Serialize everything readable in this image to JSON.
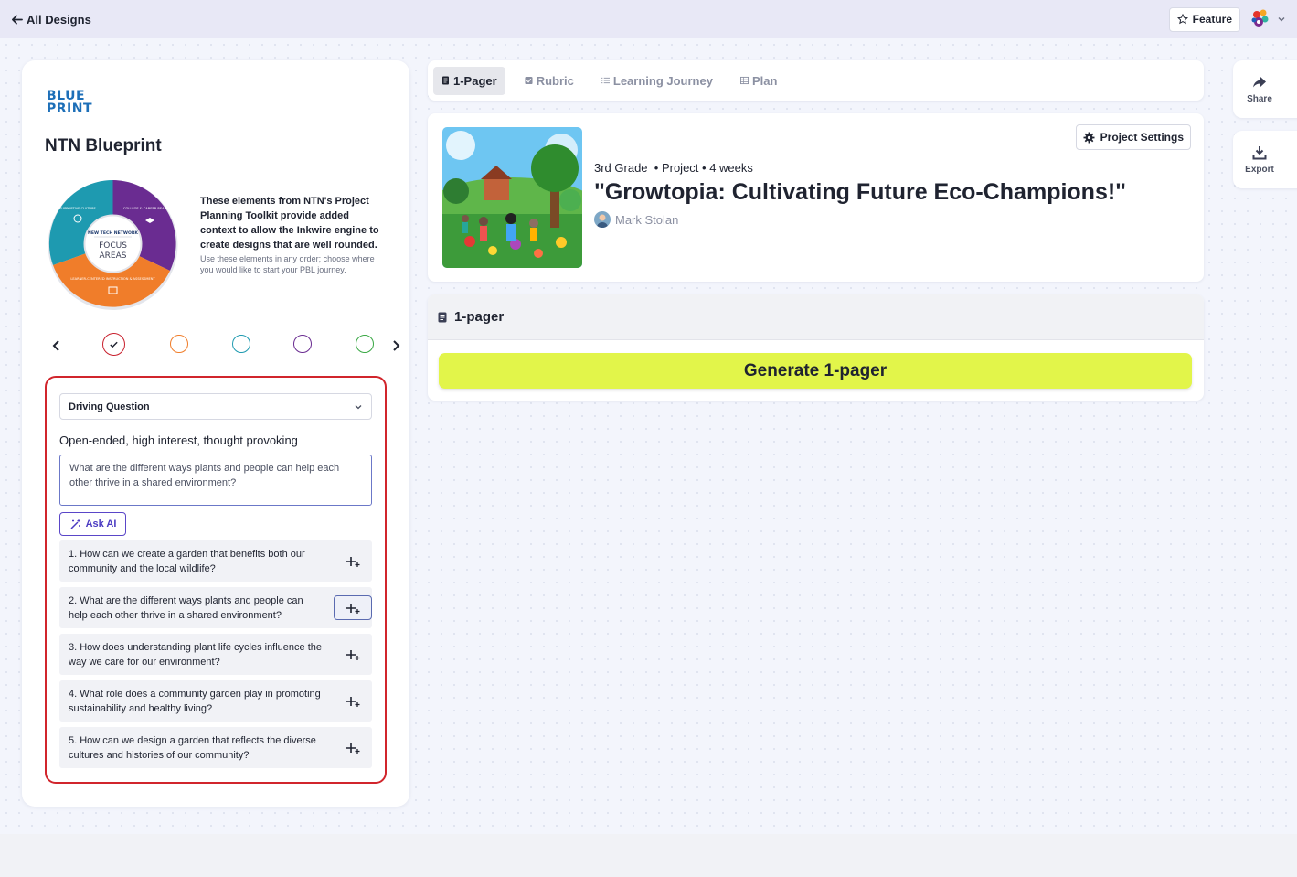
{
  "topbar": {
    "back_label": "All Designs",
    "feature_label": "Feature"
  },
  "left_panel": {
    "logo_line1": "BLUE",
    "logo_line2": "PRINT",
    "title": "NTN Blueprint",
    "wheel": {
      "center_top": "NEW TECH NETWORK",
      "center_main_1": "FOCUS",
      "center_main_2": "AREAS",
      "seg_teal": "SUPPORTIVE CULTURE",
      "seg_purple": "COLLEGE & CAREER READINESS",
      "seg_orange": "LEARNER-CENTERED INSTRUCTION & ASSESSMENT"
    },
    "desc_bold": "These elements from NTN's Project Planning Toolkit provide added context to allow the Inkwire engine to create designs that are well rounded.",
    "desc_small": "Use these elements in any order; choose where you would like to start your PBL journey.",
    "step_colors": [
      "#c8202d",
      "#f07d2a",
      "#1e9ab0",
      "#6a2c91",
      "#3aa845"
    ]
  },
  "driving_question": {
    "select_value": "Driving Question",
    "subtitle": "Open-ended, high interest, thought provoking",
    "textarea_value": "What are the different ways plants and people can help each other thrive in a shared environment?",
    "ask_ai_label": "Ask AI",
    "suggestions": [
      "1. How can we create a garden that benefits both our community and the local wildlife?",
      "2. What are the different ways plants and people can help each other thrive in a shared environment?",
      "3. How does understanding plant life cycles influence the way we care for our environment?",
      "4. What role does a community garden play in promoting sustainability and healthy living?",
      "5. How can we design a garden that reflects the diverse cultures and histories of our community?"
    ]
  },
  "tabs": [
    {
      "label": "1-Pager",
      "icon": "doc-icon"
    },
    {
      "label": "Rubric",
      "icon": "check-square-icon"
    },
    {
      "label": "Learning Journey",
      "icon": "list-icon"
    },
    {
      "label": "Plan",
      "icon": "table-icon"
    }
  ],
  "project": {
    "grade": "3rd Grade",
    "type": "• Project",
    "duration": "• 4 weeks",
    "title": "\"Growtopia: Cultivating Future Eco-Champions!\"",
    "author": "Mark Stolan",
    "settings_label": "Project Settings"
  },
  "onepager": {
    "header": "1-pager",
    "generate_label": "Generate 1-pager"
  },
  "side_actions": {
    "share_label": "Share",
    "export_label": "Export"
  }
}
